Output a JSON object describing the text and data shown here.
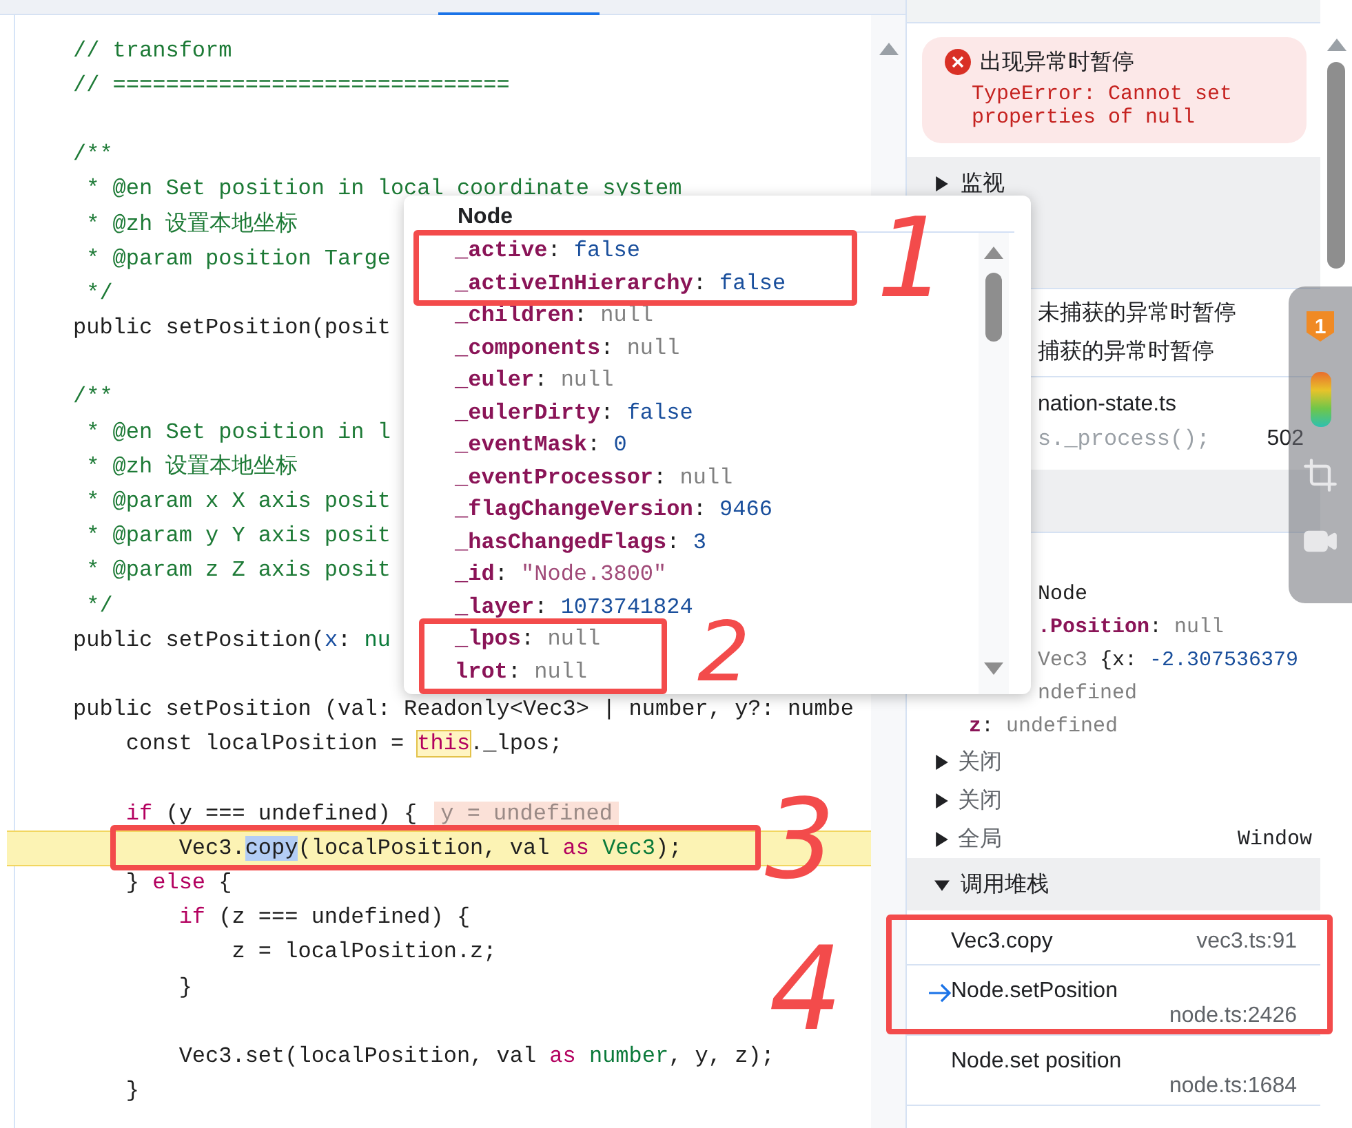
{
  "editor": {
    "lines": [
      {
        "current": false,
        "segments": [
          {
            "t": "// transform",
            "kind": "comment"
          }
        ]
      },
      {
        "current": false,
        "segments": [
          {
            "t": "// ==============================",
            "kind": "comment"
          }
        ]
      },
      {
        "current": false
      },
      {
        "current": false,
        "segments": [
          {
            "t": "/**",
            "kind": "comment"
          }
        ]
      },
      {
        "current": false,
        "segments": [
          {
            "t": " * @en Set position in local coordinate system",
            "kind": "comment"
          }
        ]
      },
      {
        "current": false,
        "segments": [
          {
            "t": " * @zh 设置本地坐标",
            "kind": "comment"
          }
        ]
      },
      {
        "current": false,
        "segments": [
          {
            "t": " * @param position Targe",
            "kind": "comment"
          }
        ]
      },
      {
        "current": false,
        "segments": [
          {
            "t": " */",
            "kind": "comment"
          }
        ]
      },
      {
        "current": false,
        "segments": [
          {
            "t": "public setPosition(posit",
            "kind": "plain"
          }
        ]
      },
      {
        "current": false
      },
      {
        "current": false,
        "segments": [
          {
            "t": "/**",
            "kind": "comment"
          }
        ]
      },
      {
        "current": false,
        "segments": [
          {
            "t": " * @en Set position in l",
            "kind": "comment"
          }
        ]
      },
      {
        "current": false,
        "segments": [
          {
            "t": " * @zh 设置本地坐标",
            "kind": "comment"
          }
        ]
      },
      {
        "current": false,
        "segments": [
          {
            "t": " * @param x X axis posit",
            "kind": "comment"
          }
        ]
      },
      {
        "current": false,
        "segments": [
          {
            "t": " * @param y Y axis posit",
            "kind": "comment"
          }
        ]
      },
      {
        "current": false,
        "segments": [
          {
            "t": " * @param z Z axis posit",
            "kind": "comment"
          }
        ]
      },
      {
        "current": false,
        "segments": [
          {
            "t": " */",
            "kind": "comment"
          }
        ]
      },
      {
        "current": false,
        "segments": [
          {
            "t": "public setPosition(",
            "kind": "plain"
          },
          {
            "t": "x",
            "kind": "param"
          },
          {
            "t": ": ",
            "kind": "plain"
          },
          {
            "t": "nu",
            "kind": "type"
          }
        ]
      },
      {
        "current": false
      },
      {
        "current": false,
        "segments": [
          {
            "t": "public setPosition (val: Readonly<Vec3> | number, y?: numbe",
            "kind": "plain"
          }
        ]
      },
      {
        "current": false,
        "segments": [
          {
            "t": "    const localPosition = ",
            "kind": "plain"
          },
          {
            "t": "this",
            "kind": "this"
          },
          {
            "t": "._lpos;",
            "kind": "plain"
          }
        ]
      },
      {
        "current": false
      },
      {
        "current": false,
        "segments": [
          {
            "t": "    if",
            "kind": "keyword"
          },
          {
            "t": " (y === undefined) {",
            "kind": "plain"
          }
        ],
        "inline_value": "y = undefined"
      },
      {
        "current": true,
        "segments": [
          {
            "t": "        Vec3.",
            "kind": "plain"
          },
          {
            "t": "copy",
            "kind": "selection"
          },
          {
            "t": "(localPosition, val ",
            "kind": "plain"
          },
          {
            "t": "as ",
            "kind": "keyword"
          },
          {
            "t": "Vec3",
            "kind": "type"
          },
          {
            "t": ");",
            "kind": "plain"
          }
        ]
      },
      {
        "current": false,
        "segments": [
          {
            "t": "    } ",
            "kind": "plain"
          },
          {
            "t": "else",
            "kind": "keyword"
          },
          {
            "t": " {",
            "kind": "plain"
          }
        ]
      },
      {
        "current": false,
        "segments": [
          {
            "t": "        if",
            "kind": "keyword"
          },
          {
            "t": " (z === undefined) {",
            "kind": "plain"
          }
        ]
      },
      {
        "current": false,
        "segments": [
          {
            "t": "            z = localPosition.z;",
            "kind": "plain"
          }
        ]
      },
      {
        "current": false,
        "segments": [
          {
            "t": "        }",
            "kind": "plain"
          }
        ]
      },
      {
        "current": false
      },
      {
        "current": false,
        "segments": [
          {
            "t": "        Vec3.set(localPosition, val ",
            "kind": "plain"
          },
          {
            "t": "as ",
            "kind": "keyword"
          },
          {
            "t": "number",
            "kind": "type"
          },
          {
            "t": ", y, z);",
            "kind": "plain"
          }
        ]
      },
      {
        "current": false,
        "segments": [
          {
            "t": "    }",
            "kind": "plain"
          }
        ]
      }
    ]
  },
  "popup": {
    "title": "Node",
    "properties": [
      [
        {
          "t": "_active",
          "kind": "key"
        },
        {
          "t": ": ",
          "kind": "plain"
        },
        {
          "t": "false",
          "kind": "number"
        }
      ],
      [
        {
          "t": "_activeInHierarchy",
          "kind": "key"
        },
        {
          "t": ": ",
          "kind": "plain"
        },
        {
          "t": "false",
          "kind": "number"
        }
      ],
      [
        {
          "t": "_children",
          "kind": "key"
        },
        {
          "t": ": ",
          "kind": "plain"
        },
        {
          "t": "null",
          "kind": "dim"
        }
      ],
      [
        {
          "t": "_components",
          "kind": "key"
        },
        {
          "t": ": ",
          "kind": "plain"
        },
        {
          "t": "null",
          "kind": "dim"
        }
      ],
      [
        {
          "t": "_euler",
          "kind": "key"
        },
        {
          "t": ": ",
          "kind": "plain"
        },
        {
          "t": "null",
          "kind": "dim"
        }
      ],
      [
        {
          "t": "_eulerDirty",
          "kind": "key"
        },
        {
          "t": ": ",
          "kind": "plain"
        },
        {
          "t": "false",
          "kind": "number"
        }
      ],
      [
        {
          "t": "_eventMask",
          "kind": "key"
        },
        {
          "t": ": ",
          "kind": "plain"
        },
        {
          "t": "0",
          "kind": "number"
        }
      ],
      [
        {
          "t": "_eventProcessor",
          "kind": "key"
        },
        {
          "t": ": ",
          "kind": "plain"
        },
        {
          "t": "null",
          "kind": "dim"
        }
      ],
      [
        {
          "t": "_flagChangeVersion",
          "kind": "key"
        },
        {
          "t": ": ",
          "kind": "plain"
        },
        {
          "t": "9466",
          "kind": "number"
        }
      ],
      [
        {
          "t": "_hasChangedFlags",
          "kind": "key"
        },
        {
          "t": ": ",
          "kind": "plain"
        },
        {
          "t": "3",
          "kind": "number"
        }
      ],
      [
        {
          "t": "_id",
          "kind": "key"
        },
        {
          "t": ": ",
          "kind": "plain"
        },
        {
          "t": "\"Node.3800\"",
          "kind": "string"
        }
      ],
      [
        {
          "t": "_layer",
          "kind": "key"
        },
        {
          "t": ": ",
          "kind": "plain"
        },
        {
          "t": "1073741824",
          "kind": "number"
        }
      ],
      [
        {
          "t": "_lpos",
          "kind": "key"
        },
        {
          "t": ": ",
          "kind": "plain"
        },
        {
          "t": "null",
          "kind": "dim"
        }
      ],
      [
        {
          "t": "lrot",
          "kind": "key"
        },
        {
          "t": ": ",
          "kind": "plain"
        },
        {
          "t": "null",
          "kind": "dim"
        }
      ]
    ]
  },
  "debugger": {
    "exception": {
      "title": "出现异常时暂停",
      "message": "TypeError: Cannot set properties of null"
    },
    "watch": {
      "label": "监视",
      "expanded": false
    },
    "breakpoint_options": [
      "未捕获的异常时暂停",
      "捕获的异常时暂停"
    ],
    "breakpoint": {
      "file": "nation-state.ts",
      "code": "s._process();",
      "line": "502"
    },
    "scope_lines": [
      {
        "kind": "clipped",
        "segments": [
          {
            "t": "Node",
            "kind": "plain"
          }
        ]
      },
      {
        "kind": "clipped",
        "segments": [
          {
            "t": ".Position",
            "kind": "key"
          },
          {
            "t": ": ",
            "kind": "plain"
          },
          {
            "t": "null",
            "kind": "dim"
          }
        ]
      },
      {
        "kind": "clipped",
        "segments": [
          {
            "t": "Vec3",
            "kind": "dim"
          },
          {
            "t": " {x: ",
            "kind": "plain"
          },
          {
            "t": "-2.307536379",
            "kind": "number"
          }
        ]
      },
      {
        "kind": "clipped",
        "segments": [
          {
            "t": "ndefined",
            "kind": "dim"
          }
        ]
      },
      {
        "kind": "property",
        "segments": [
          {
            "t": "z",
            "kind": "key"
          },
          {
            "t": ": ",
            "kind": "plain"
          },
          {
            "t": "undefined",
            "kind": "dim"
          }
        ]
      }
    ],
    "scope_groups": [
      {
        "label": "关闭",
        "expanded": false
      },
      {
        "label": "关闭",
        "expanded": false
      },
      {
        "label": "全局",
        "value": "Window",
        "expanded": false
      }
    ],
    "call_stack": {
      "label": "调用堆栈",
      "expanded": true,
      "frames": [
        {
          "name": "Vec3.copy",
          "location": "vec3.ts:91",
          "selected": false
        },
        {
          "name": "Node.setPosition",
          "location": "node.ts:2426",
          "selected": true
        },
        {
          "name": "Node.set position",
          "location": "node.ts:1684",
          "selected": false
        }
      ]
    }
  },
  "overlay_toolbar": {
    "badge": "1"
  },
  "annotations": [
    {
      "label": "1"
    },
    {
      "label": "2"
    },
    {
      "label": "3"
    },
    {
      "label": "4"
    }
  ]
}
